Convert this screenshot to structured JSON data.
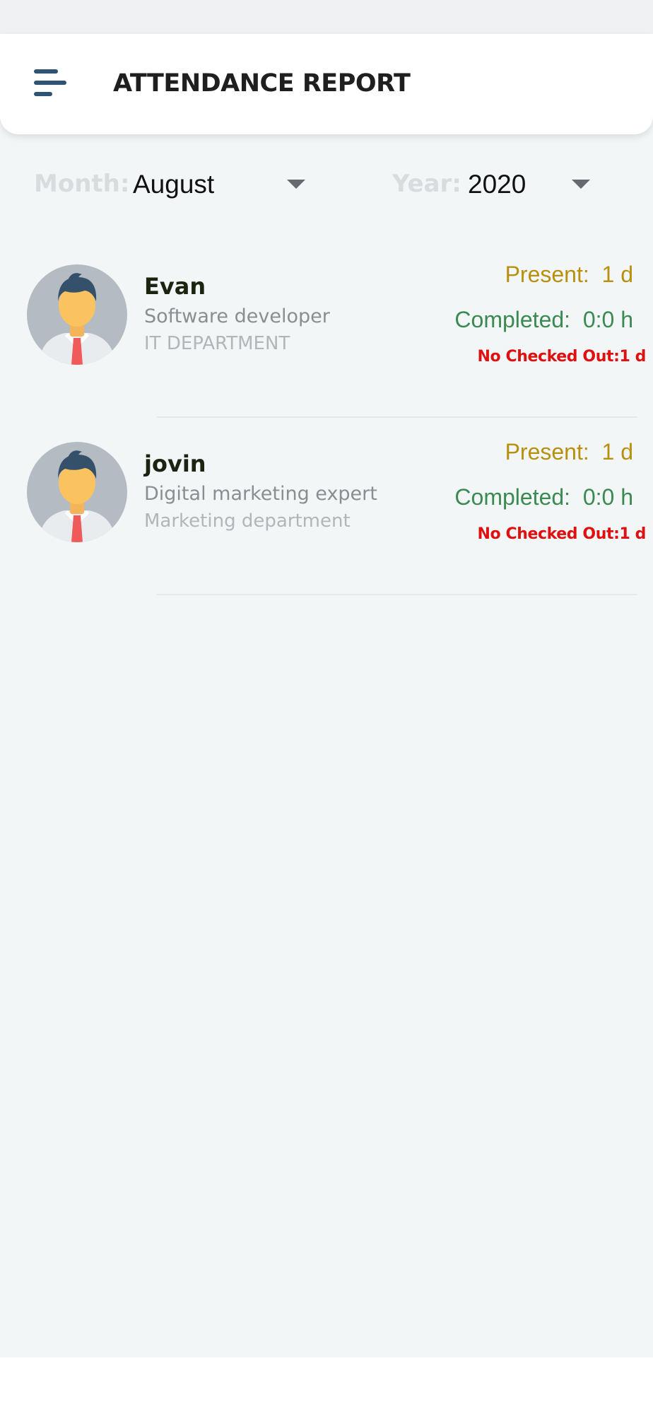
{
  "header": {
    "title": "ATTENDANCE REPORT",
    "menu_icon": "menu-icon"
  },
  "filters": {
    "month_label": "Month:",
    "month_value": "August",
    "year_label": "Year:",
    "year_value": "2020"
  },
  "employees": [
    {
      "name": "Evan",
      "role": "Software developer",
      "department": "IT DEPARTMENT",
      "present": "Present:  1 d",
      "completed": "Completed:  0:0 h",
      "no_checked_out": "No Checked Out:1 d",
      "avatar_icon": "avatar-icon"
    },
    {
      "name": "jovin",
      "role": "Digital marketing expert",
      "department": "Marketing department",
      "present": "Present:  1 d",
      "completed": "Completed:  0:0 h",
      "no_checked_out": "No Checked Out:1 d",
      "avatar_icon": "avatar-icon"
    }
  ],
  "colors": {
    "present": "#b8900e",
    "completed": "#3b8a52",
    "no_checked_out": "#df1010",
    "menu_icon": "#2f5277",
    "background": "#f2f6f7"
  }
}
